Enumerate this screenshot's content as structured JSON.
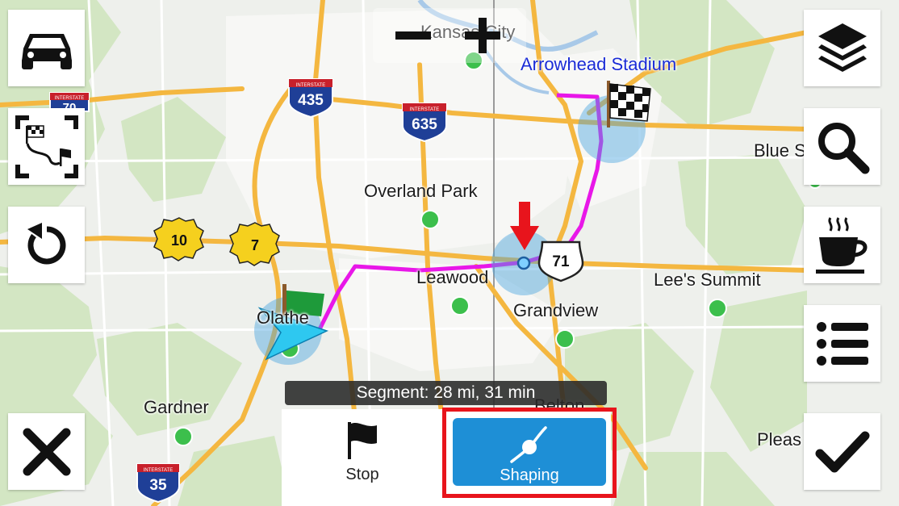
{
  "map": {
    "cities": [
      {
        "name": "Kansas City"
      },
      {
        "name": "Overland Park"
      },
      {
        "name": "Leawood"
      },
      {
        "name": "Grandview"
      },
      {
        "name": "Lee's Summit"
      },
      {
        "name": "Olathe"
      },
      {
        "name": "Gardner"
      },
      {
        "name": "Belton"
      },
      {
        "name": "Blue S"
      },
      {
        "name": "Pleas"
      }
    ],
    "poi": {
      "name": "Arrowhead Stadium"
    },
    "shields": [
      {
        "label": "435",
        "kind": "interstate"
      },
      {
        "label": "635",
        "kind": "interstate"
      },
      {
        "label": "35",
        "kind": "interstate"
      },
      {
        "label": "70",
        "kind": "interstate"
      },
      {
        "label": "71",
        "kind": "us-highway"
      },
      {
        "label": "10",
        "kind": "state"
      },
      {
        "label": "7",
        "kind": "state"
      }
    ],
    "shield_header": "INTERSTATE",
    "route_color": "#e817e8",
    "start_marker_color": "#2ec8f0",
    "shaping_point_color": "#4aa3e0"
  },
  "left_toolbar": [
    {
      "name": "car-icon",
      "action": "vehicle-profile"
    },
    {
      "name": "route-overview-icon",
      "action": "show-route-overview"
    },
    {
      "name": "undo-icon",
      "action": "undo"
    },
    {
      "name": "close-icon",
      "action": "cancel"
    }
  ],
  "right_toolbar": [
    {
      "name": "layers-icon",
      "action": "map-layers"
    },
    {
      "name": "search-icon",
      "action": "search"
    },
    {
      "name": "coffee-cup-icon",
      "action": "services"
    },
    {
      "name": "list-icon",
      "action": "route-list"
    },
    {
      "name": "checkmark-icon",
      "action": "confirm"
    }
  ],
  "zoom": {
    "out_label": "−",
    "in_label": "+"
  },
  "segment": {
    "text": "Segment: 28 mi, 31 min"
  },
  "bottom_bar": {
    "stop_label": "Stop",
    "shaping_label": "Shaping",
    "active": "shaping",
    "active_color": "#1e8fd6"
  },
  "annotation": {
    "highlight_color": "#e8141c"
  }
}
